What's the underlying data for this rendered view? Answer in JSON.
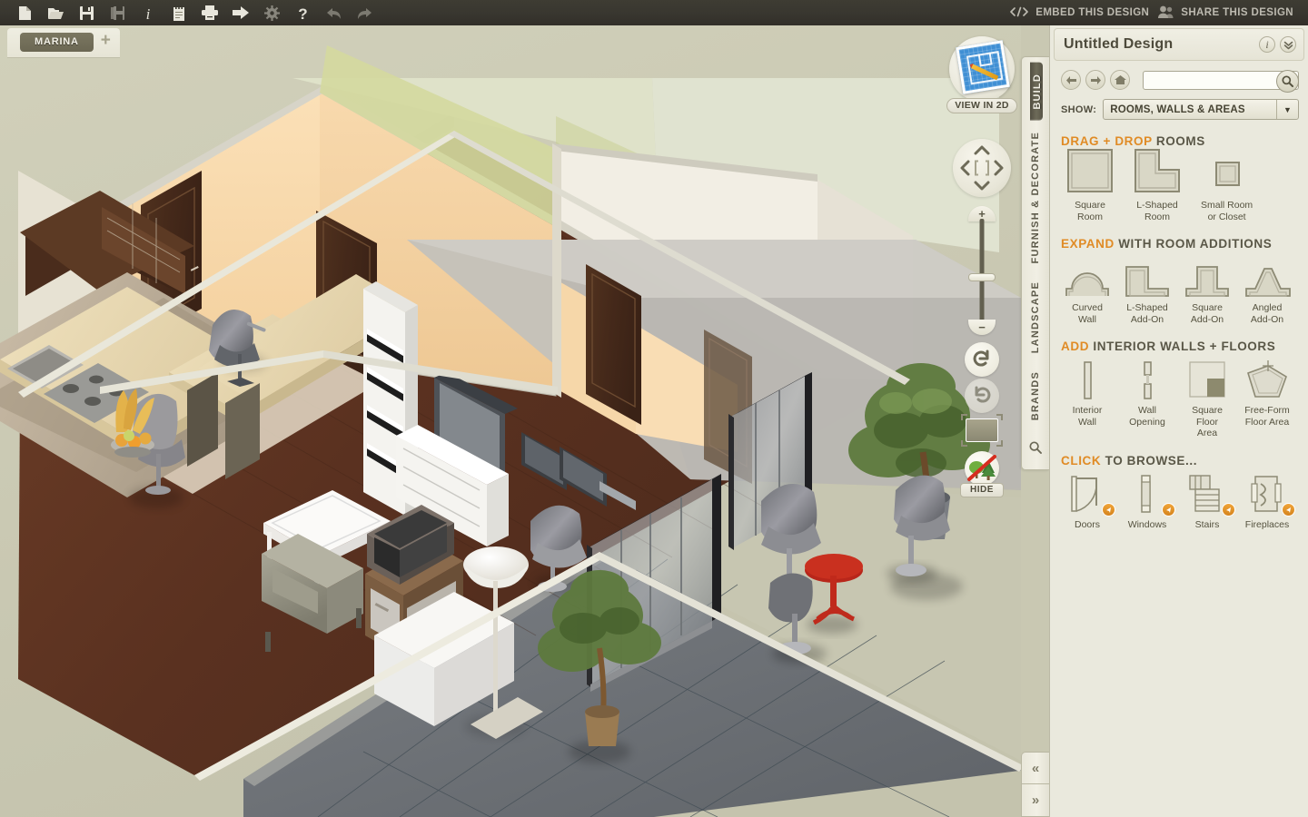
{
  "toolbar": {
    "icons": [
      {
        "name": "new-document-icon",
        "label": "New"
      },
      {
        "name": "open-folder-icon",
        "label": "Open"
      },
      {
        "name": "save-icon",
        "label": "Save"
      },
      {
        "name": "save-as-icon",
        "label": "Save As"
      },
      {
        "name": "info-icon",
        "label": "Info"
      },
      {
        "name": "notes-icon",
        "label": "Notes"
      },
      {
        "name": "print-icon",
        "label": "Print"
      },
      {
        "name": "export-icon",
        "label": "Export"
      },
      {
        "name": "settings-gear-icon",
        "label": "Settings"
      },
      {
        "name": "help-icon",
        "label": "Help"
      },
      {
        "name": "undo-icon",
        "label": "Undo"
      },
      {
        "name": "redo-icon",
        "label": "Redo"
      }
    ],
    "embed_label": "EMBED THIS DESIGN",
    "embed_icon": "code-icon",
    "share_label": "SHARE THIS DESIGN",
    "share_icon": "people-icon"
  },
  "tabbar": {
    "tabs": [
      {
        "label": "MARINA",
        "active": true
      }
    ],
    "add_label": "+"
  },
  "viewport": {
    "view2d_label": "VIEW IN 2D",
    "hide_label": "HIDE",
    "pan": {
      "up": "▲",
      "down": "▼",
      "left": "◀",
      "right": "▶"
    },
    "zoom_in": "+",
    "zoom_out": "−"
  },
  "vertical_tabs": [
    {
      "label": "BUILD",
      "active": true
    },
    {
      "label": "FURNISH & DECORATE",
      "active": false
    },
    {
      "label": "LANDSCAPE",
      "active": false
    },
    {
      "label": "BRANDS",
      "active": false
    }
  ],
  "panel": {
    "title": "Untitled Design",
    "info_icon": "info-icon",
    "collapse_icon": "chevron-double-down-icon",
    "nav": {
      "back_icon": "arrow-left-icon",
      "forward_icon": "arrow-right-icon",
      "home_icon": "home-icon",
      "search_icon": "search-icon"
    },
    "search": {
      "value": "",
      "placeholder": ""
    },
    "show_label": "SHOW:",
    "show_value": "ROOMS, WALLS & AREAS",
    "sections": [
      {
        "title_hl": "DRAG + DROP",
        "title_rest": "ROOMS",
        "items": [
          {
            "icon": "square-room-icon",
            "cap": "Square\nRoom"
          },
          {
            "icon": "l-shaped-room-icon",
            "cap": "L-Shaped\nRoom"
          },
          {
            "icon": "small-room-icon",
            "cap": "Small Room\nor Closet"
          }
        ]
      },
      {
        "title_hl": "EXPAND",
        "title_rest": "WITH ROOM ADDITIONS",
        "items": [
          {
            "icon": "curved-wall-icon",
            "cap": "Curved\nWall"
          },
          {
            "icon": "l-shaped-addon-icon",
            "cap": "L-Shaped\nAdd-On"
          },
          {
            "icon": "square-addon-icon",
            "cap": "Square\nAdd-On"
          },
          {
            "icon": "angled-addon-icon",
            "cap": "Angled\nAdd-On"
          }
        ]
      },
      {
        "title_hl": "ADD",
        "title_rest": "INTERIOR WALLS + FLOORS",
        "items": [
          {
            "icon": "interior-wall-icon",
            "cap": "Interior\nWall"
          },
          {
            "icon": "wall-opening-icon",
            "cap": "Wall\nOpening"
          },
          {
            "icon": "square-floor-area-icon",
            "cap": "Square Floor\nArea"
          },
          {
            "icon": "free-form-floor-area-icon",
            "cap": "Free-Form\nFloor Area"
          }
        ]
      },
      {
        "title_hl": "CLICK",
        "title_rest": "TO BROWSE...",
        "items": [
          {
            "icon": "door-icon",
            "cap": "Doors",
            "badge": true
          },
          {
            "icon": "window-icon",
            "cap": "Windows",
            "badge": true
          },
          {
            "icon": "stairs-icon",
            "cap": "Stairs",
            "badge": true
          },
          {
            "icon": "fireplace-icon",
            "cap": "Fireplaces",
            "badge": true
          }
        ]
      }
    ]
  },
  "collapse": {
    "prev": "«",
    "next": "»"
  },
  "colors": {
    "accent_orange": "#e08b25",
    "panel_bg": "#eae9dd",
    "toolbar_bg": "#393730",
    "scene_bg": "#c9c8b2",
    "tab_active": "#6b6753",
    "wall_peach": "#f7d9ab",
    "wall_green": "#d4d8a8",
    "wall_white": "#f0ece2",
    "floor_wood": "#5b3220",
    "terrace_tile": "#6f7378"
  }
}
